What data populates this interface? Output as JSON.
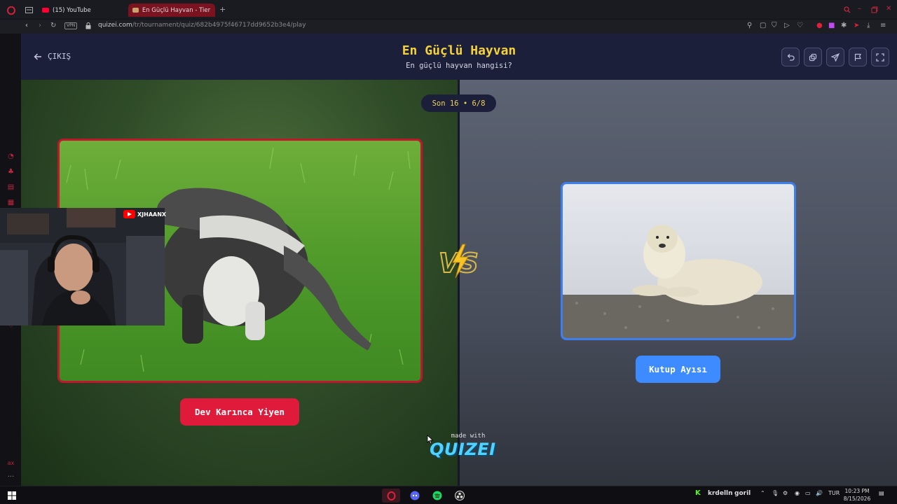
{
  "browser": {
    "tabs": [
      {
        "label": "(15) YouTube",
        "active": false
      },
      {
        "label": "En Güçlü Hayvan - Tier List",
        "active": true
      }
    ],
    "new_tab_label": "+",
    "vpn_label": "VPN",
    "url_host": "quizei.com",
    "url_path": "/tr/tournament/quiz/682b4975f46717dd9652b3e4/play"
  },
  "header": {
    "exit_label": "ÇIKIŞ",
    "title": "En Güçlü Hayvan",
    "subtitle": "En güçlü hayvan hangisi?",
    "tools": [
      "undo-icon",
      "share-icon",
      "send-icon",
      "flag-icon",
      "fullscreen-icon"
    ]
  },
  "arena": {
    "round_label": "Son 16 • 6/8",
    "left_choice": {
      "label": "Dev Karınca Yiyen",
      "accent": "#e01a3a"
    },
    "right_choice": {
      "label": "Kutup Ayısı",
      "accent": "#3d8bff"
    }
  },
  "branding": {
    "made_with": "made with",
    "logo": "QUIZEI"
  },
  "webcam": {
    "channel": "XJHAANX"
  },
  "taskbar": {
    "tray_app_label": "krdelln",
    "tray_app_label2": "goril",
    "lang": "TUR",
    "time": "10:23 PM",
    "date": "8/15/2026"
  },
  "colors": {
    "title": "#f5d23a",
    "header_bg": "#1c1f3a",
    "browser_accent": "#c2263c"
  }
}
